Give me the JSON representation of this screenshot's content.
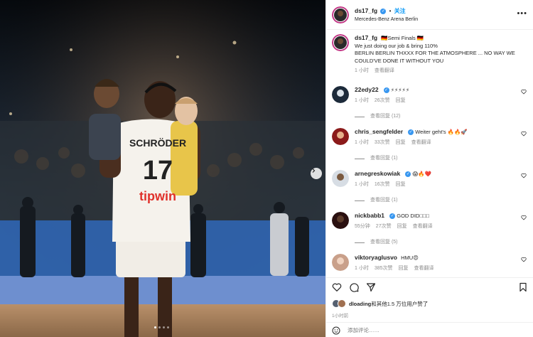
{
  "post": {
    "username": "ds17_fg",
    "follow_label": "关注",
    "location": "Mercedes-Benz Arena Berlin",
    "caption": {
      "username": "ds17_fg",
      "text_line1": "🇩🇪Semi Finals 🇩🇪",
      "text_line2": "We just doing our job & bring 110%",
      "text_line3": "BERLIN BERLIN THXXX FOR THE ATMOSPHERE ... NO WAY WE COULD'VE DONE IT WITHOUT YOU",
      "time": "1 小时",
      "translate": "查看翻译"
    }
  },
  "photo": {
    "jersey_name": "SCHRÖDER",
    "jersey_number": "17",
    "sponsor": "tipwin"
  },
  "comments": [
    {
      "username": "22edy22",
      "text": "⚡⚡⚡⚡⚡",
      "time": "1 小时",
      "likes": "26次赞",
      "reply": "回复",
      "translate": "",
      "replies": "查看回复 (12)"
    },
    {
      "username": "chris_sengfelder",
      "text": "Weiter geht's 🔥🔥🚀",
      "time": "1 小时",
      "likes": "33次赞",
      "reply": "回复",
      "translate": "查看翻译",
      "replies": "查看回复 (1)"
    },
    {
      "username": "arnegreskowiak",
      "text": "😱🔥❤️",
      "time": "1 小时",
      "likes": "16次赞",
      "reply": "回复",
      "translate": "",
      "replies": "查看回复 (1)"
    },
    {
      "username": "nickbabb1",
      "text": "GOD DID□□□",
      "time": "55分钟",
      "likes": "27次赞",
      "reply": "回复",
      "translate": "查看翻译",
      "replies": "查看回复 (5)"
    },
    {
      "username": "viktoryaglusvo",
      "text": "HMU😍",
      "time": "1 小时",
      "likes": "385次赞",
      "reply": "回复",
      "translate": "查看翻译",
      "replies": ""
    }
  ],
  "likes": {
    "user": "dloading",
    "suffix": "和其他1.5 万位用户赞了"
  },
  "posted": "1小时前",
  "comment_placeholder": "添加评论……",
  "icons": {
    "like": "heart-icon",
    "comment": "comment-icon",
    "share": "share-icon",
    "save": "bookmark-icon",
    "next": "chevron-right-icon",
    "emoji": "emoji-icon"
  },
  "colors": {
    "accent": "#0095f6",
    "verified": "#3897f0",
    "muted": "#8e8e8e"
  }
}
